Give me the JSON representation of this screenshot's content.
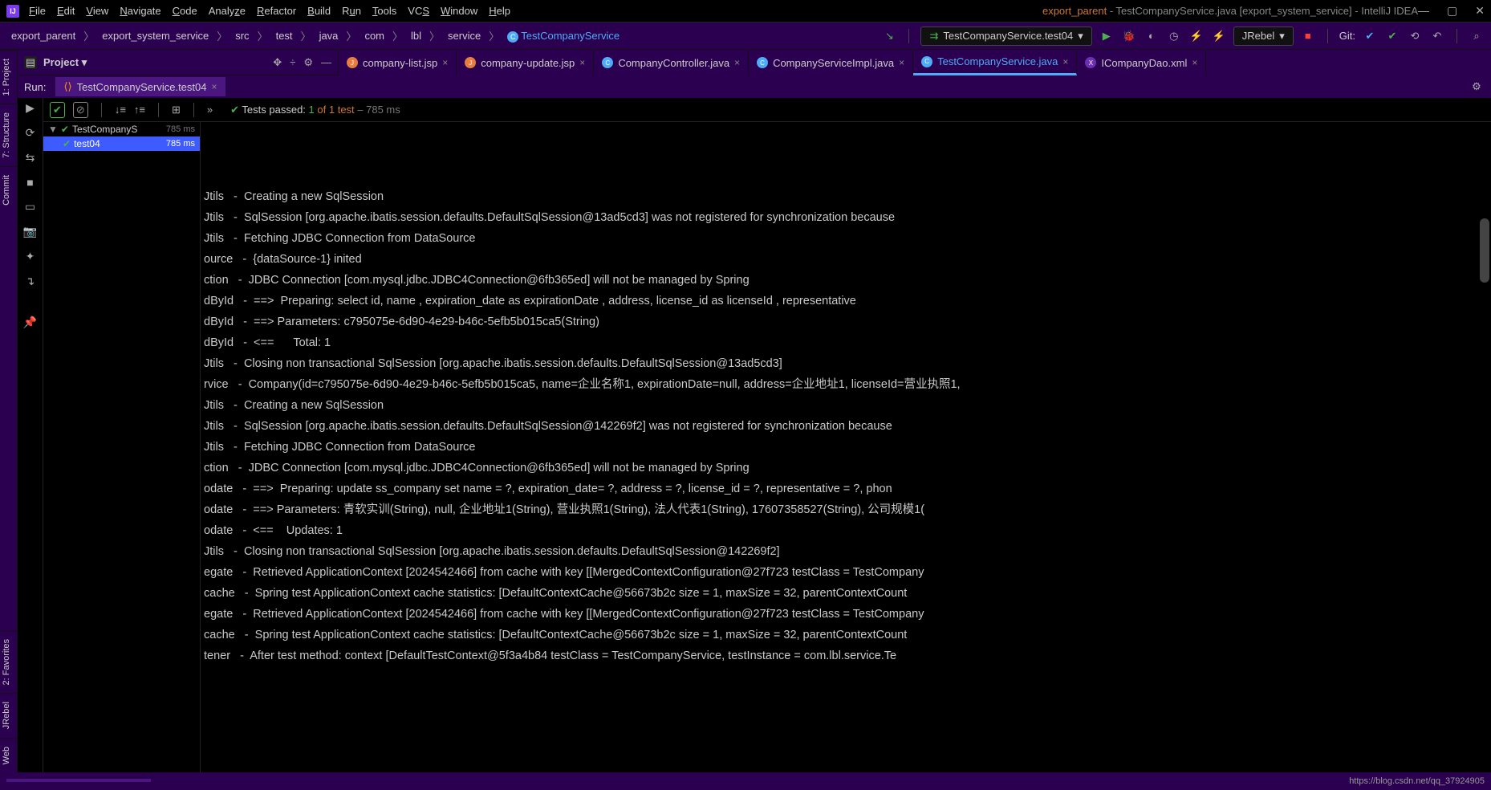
{
  "window": {
    "title_prefix": "export_parent",
    "title_file": "TestCompanyService.java",
    "title_module": "[export_system_service]",
    "title_app": "IntelliJ IDEA"
  },
  "menu": [
    "File",
    "Edit",
    "View",
    "Navigate",
    "Code",
    "Analyze",
    "Refactor",
    "Build",
    "Run",
    "Tools",
    "VCS",
    "Window",
    "Help"
  ],
  "breadcrumb": [
    "export_parent",
    "export_system_service",
    "src",
    "test",
    "java",
    "com",
    "lbl",
    "service",
    "TestCompanyService"
  ],
  "run_config": "TestCompanyService.test04",
  "jrebel": "JRebel",
  "git_label": "Git:",
  "project_panel": {
    "title": "Project"
  },
  "editor_tabs": [
    {
      "label": "company-list.jsp",
      "type": "jsp"
    },
    {
      "label": "company-update.jsp",
      "type": "jsp"
    },
    {
      "label": "CompanyController.java",
      "type": "java"
    },
    {
      "label": "CompanyServiceImpl.java",
      "type": "java"
    },
    {
      "label": "TestCompanyService.java",
      "type": "java",
      "active": true
    },
    {
      "label": "ICompanyDao.xml",
      "type": "xml"
    }
  ],
  "run_panel": {
    "label": "Run:",
    "tab": "TestCompanyService.test04",
    "tests_status_prefix": "Tests passed:",
    "tests_status_count": "1",
    "tests_status_of": "of 1 test",
    "tests_status_time": "– 785 ms"
  },
  "test_tree": {
    "root": {
      "name": "TestCompanyS",
      "time": "785 ms"
    },
    "child": {
      "name": "test04",
      "time": "785 ms"
    }
  },
  "console_lines": [
    "Jtils   -  Creating a new SqlSession",
    "Jtils   -  SqlSession [org.apache.ibatis.session.defaults.DefaultSqlSession@13ad5cd3] was not registered for synchronization because",
    "Jtils   -  Fetching JDBC Connection from DataSource",
    "ource   -  {dataSource-1} inited",
    "ction   -  JDBC Connection [com.mysql.jdbc.JDBC4Connection@6fb365ed] will not be managed by Spring",
    "dById   -  ==>  Preparing: select id, name , expiration_date as expirationDate , address, license_id as licenseId , representative ",
    "dById   -  ==> Parameters: c795075e-6d90-4e29-b46c-5efb5b015ca5(String)",
    "dById   -  <==      Total: 1",
    "Jtils   -  Closing non transactional SqlSession [org.apache.ibatis.session.defaults.DefaultSqlSession@13ad5cd3]",
    "rvice   -  Company(id=c795075e-6d90-4e29-b46c-5efb5b015ca5, name=企业名称1, expirationDate=null, address=企业地址1, licenseId=营业执照1,",
    "Jtils   -  Creating a new SqlSession",
    "Jtils   -  SqlSession [org.apache.ibatis.session.defaults.DefaultSqlSession@142269f2] was not registered for synchronization because",
    "Jtils   -  Fetching JDBC Connection from DataSource",
    "ction   -  JDBC Connection [com.mysql.jdbc.JDBC4Connection@6fb365ed] will not be managed by Spring",
    "odate   -  ==>  Preparing: update ss_company set name = ?, expiration_date= ?, address = ?, license_id = ?, representative = ?, phon",
    "odate   -  ==> Parameters: 青软实训(String), null, 企业地址1(String), 营业执照1(String), 法人代表1(String), 17607358527(String), 公司规模1(",
    "odate   -  <==    Updates: 1",
    "Jtils   -  Closing non transactional SqlSession [org.apache.ibatis.session.defaults.DefaultSqlSession@142269f2]",
    "egate   -  Retrieved ApplicationContext [2024542466] from cache with key [[MergedContextConfiguration@27f723 testClass = TestCompany",
    "cache   -  Spring test ApplicationContext cache statistics: [DefaultContextCache@56673b2c size = 1, maxSize = 32, parentContextCount",
    "egate   -  Retrieved ApplicationContext [2024542466] from cache with key [[MergedContextConfiguration@27f723 testClass = TestCompany",
    "cache   -  Spring test ApplicationContext cache statistics: [DefaultContextCache@56673b2c size = 1, maxSize = 32, parentContextCount",
    "tener   -  After test method: context [DefaultTestContext@5f3a4b84 testClass = TestCompanyService, testInstance = com.lbl.service.Te"
  ],
  "left_rail": [
    "1: Project",
    "7: Structure",
    "Commit",
    "2: Favorites",
    "JRebel",
    "Web"
  ],
  "status_url": "https://blog.csdn.net/qq_37924905"
}
